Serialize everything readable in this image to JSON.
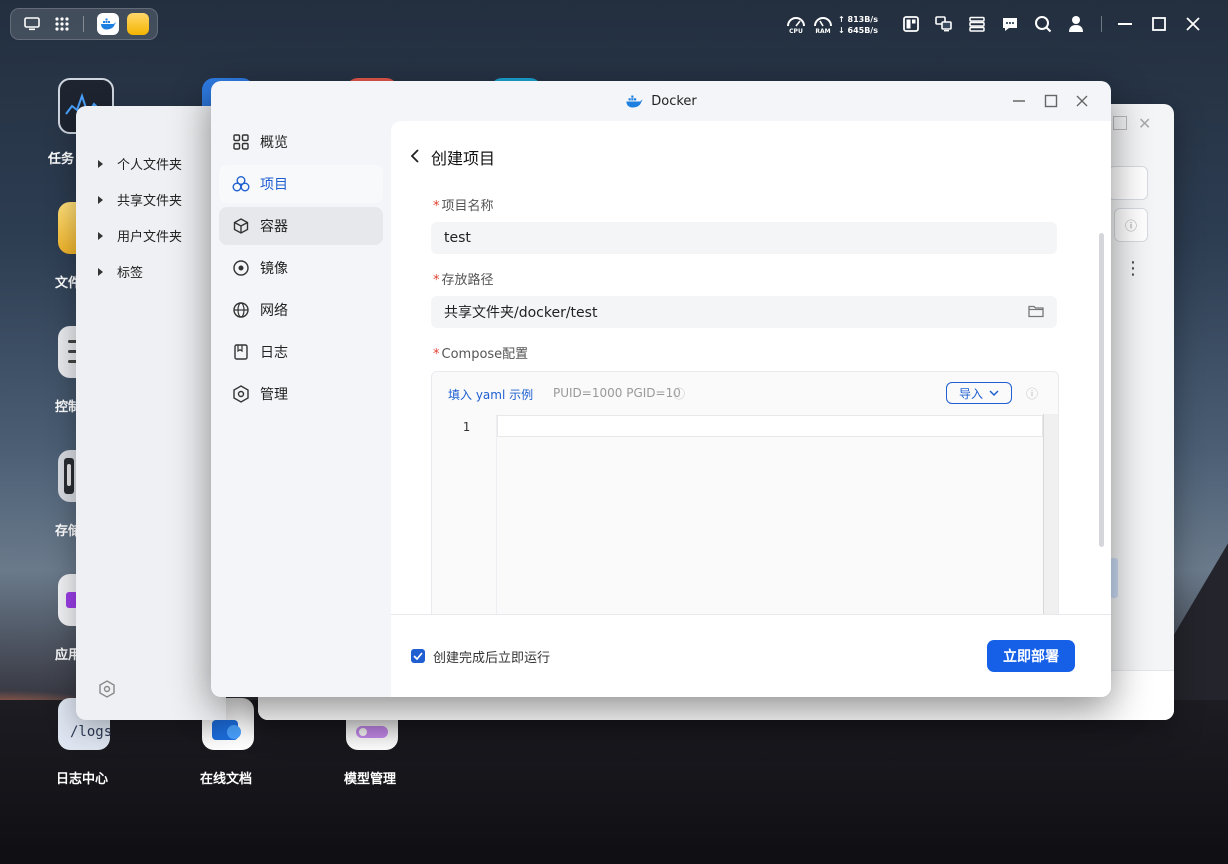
{
  "desktop": {
    "icons": [
      {
        "label": "任务"
      },
      {
        "label": "文件"
      },
      {
        "label": "控制"
      },
      {
        "label": "存储"
      },
      {
        "label": "应用"
      },
      {
        "label": "日志中心",
        "badge": "/logs"
      },
      {
        "label": "在线文档"
      },
      {
        "label": "模型管理"
      }
    ]
  },
  "topbar": {
    "cpu_label": "CPU",
    "ram_label": "RAM",
    "upload": "813B/s",
    "download": "645B/s"
  },
  "files_window": {
    "tree": [
      "个人文件夹",
      "共享文件夹",
      "用户文件夹",
      "标签"
    ]
  },
  "docker": {
    "title": "Docker",
    "nav": [
      {
        "label": "概览",
        "icon": "grid-icon"
      },
      {
        "label": "项目",
        "icon": "project-icon"
      },
      {
        "label": "容器",
        "icon": "container-icon"
      },
      {
        "label": "镜像",
        "icon": "image-icon"
      },
      {
        "label": "网络",
        "icon": "globe-icon"
      },
      {
        "label": "日志",
        "icon": "log-icon"
      },
      {
        "label": "管理",
        "icon": "settings-icon"
      }
    ],
    "active_nav": "项目",
    "page_title": "创建项目",
    "form": {
      "name_label": "项目名称",
      "name_value": "test",
      "path_label": "存放路径",
      "path_value": "共享文件夹/docker/test",
      "compose_label": "Compose配置",
      "fill_example": "填入 yaml 示例",
      "env_hint": "PUID=1000 PGID=10",
      "import_label": "导入",
      "line_number": "1"
    },
    "footer": {
      "run_after_label": "创建完成后立即运行",
      "run_after_checked": true,
      "deploy_label": "立即部署"
    }
  },
  "colors": {
    "accent": "#1660e8",
    "link": "#1f5fd1",
    "required": "#e0422f"
  }
}
